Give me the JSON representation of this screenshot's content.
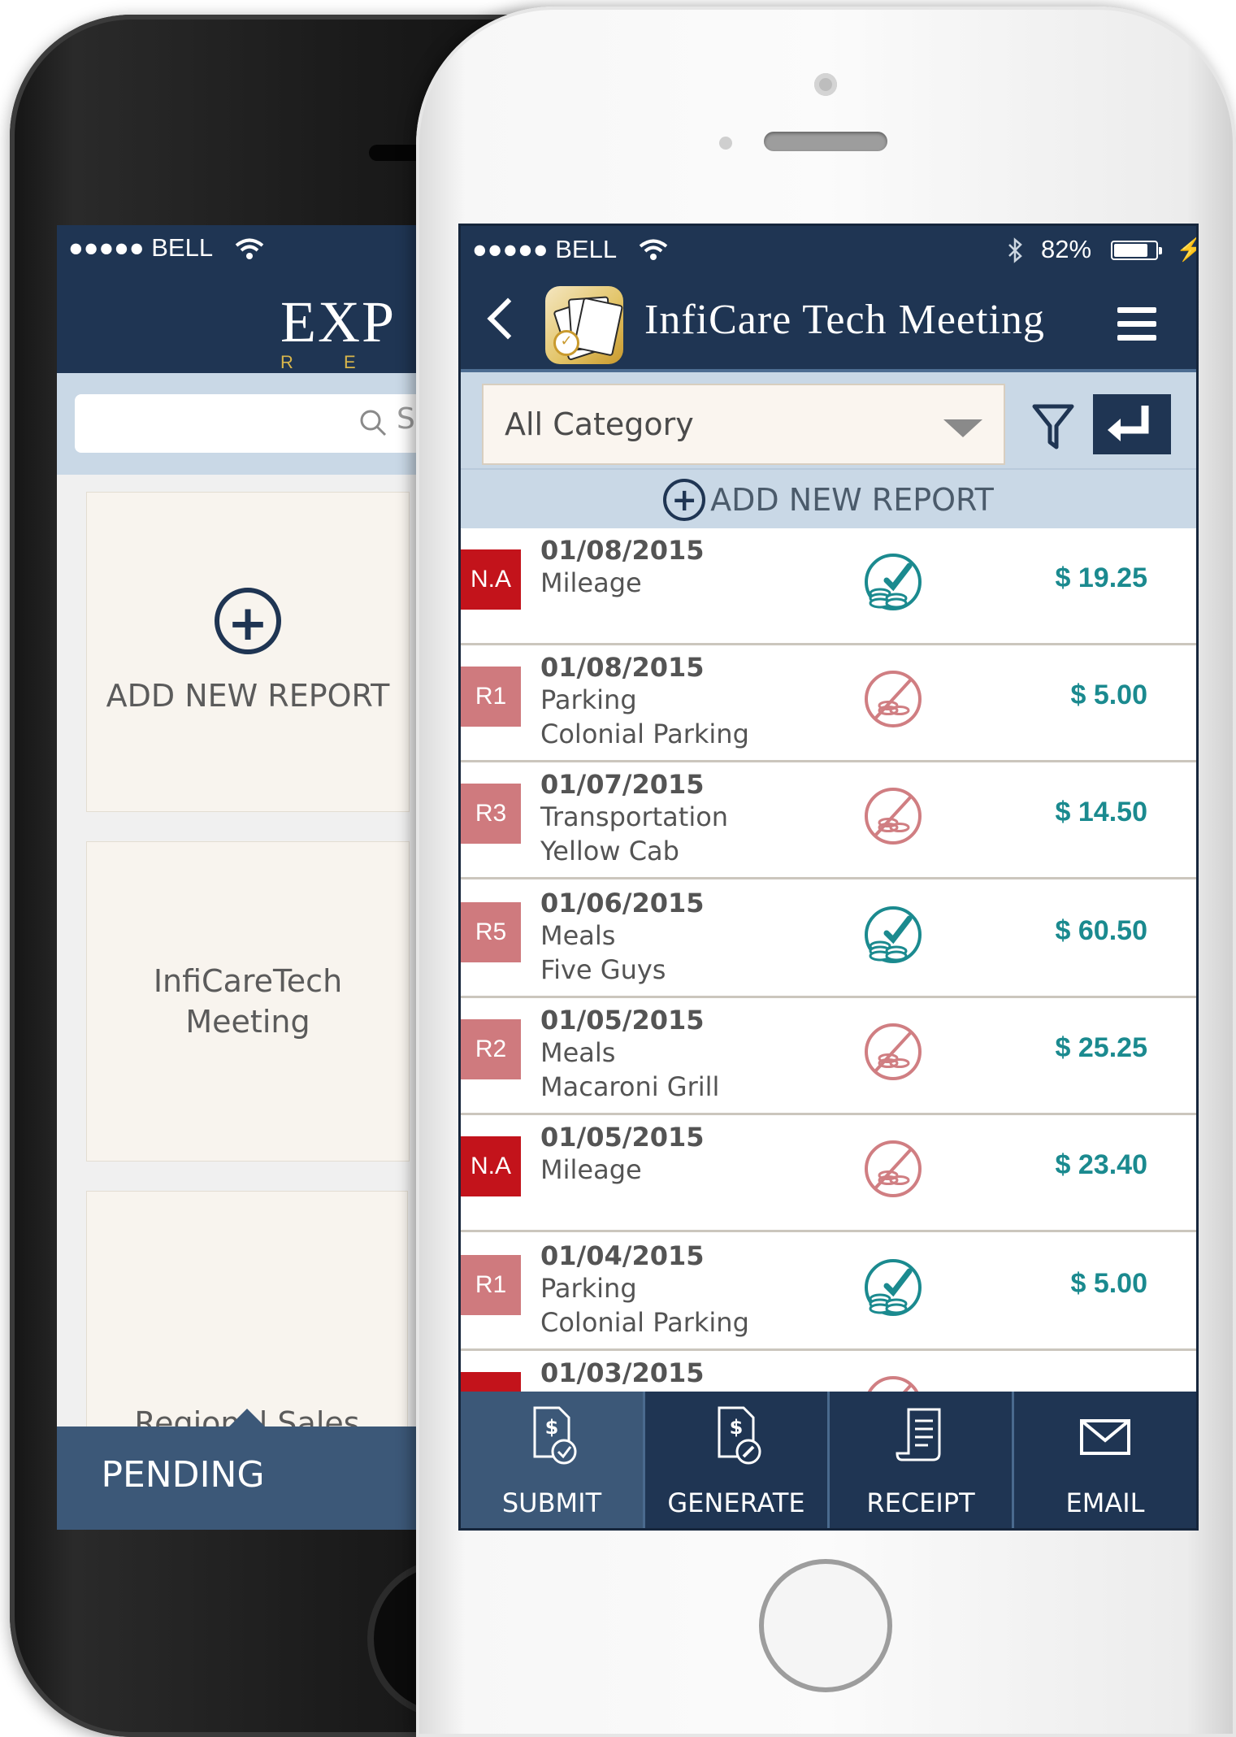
{
  "back_phone": {
    "status": {
      "carrier": "●●●●● BELL"
    },
    "logo": {
      "title": "EXP",
      "subtitle": "R E P"
    },
    "search": {
      "placeholder": "Se"
    },
    "cards": [
      {
        "label": "ADD NEW REPORT",
        "icon": "add-circle-icon"
      },
      {
        "label": "InfiCareTech Meeting"
      },
      {
        "label": "Regional Sales Meeting"
      }
    ],
    "bottom_tab": {
      "label": "PENDING"
    }
  },
  "status_bar": {
    "carrier": "●●●●● BELL",
    "battery_pct": "82%",
    "battery_level": 0.82
  },
  "header": {
    "title": "InfiCare Tech Meeting",
    "back_icon": "chevron-left-icon",
    "menu_icon": "hamburger-icon",
    "app_icon": "expense-app-icon"
  },
  "filter": {
    "category_value": "All Category",
    "filter_icon": "filter-icon",
    "enter_icon": "enter-return-icon"
  },
  "add_report": {
    "label": "ADD NEW REPORT",
    "icon": "add-circle-icon"
  },
  "expenses": [
    {
      "badge": "N.A",
      "badge_type": "na",
      "date": "01/08/2015",
      "category": "Mileage",
      "vendor": "",
      "status": "approved",
      "amount": "$ 19.25"
    },
    {
      "badge": "R1",
      "badge_type": "r",
      "date": "01/08/2015",
      "category": "Parking",
      "vendor": "Colonial Parking",
      "status": "not-submitted",
      "amount": "$ 5.00"
    },
    {
      "badge": "R3",
      "badge_type": "r",
      "date": "01/07/2015",
      "category": "Transportation",
      "vendor": "Yellow Cab",
      "status": "not-submitted",
      "amount": "$ 14.50"
    },
    {
      "badge": "R5",
      "badge_type": "r",
      "date": "01/06/2015",
      "category": "Meals",
      "vendor": "Five Guys",
      "status": "approved",
      "amount": "$ 60.50"
    },
    {
      "badge": "R2",
      "badge_type": "r",
      "date": "01/05/2015",
      "category": "Meals",
      "vendor": "Macaroni Grill",
      "status": "not-submitted",
      "amount": "$ 25.25"
    },
    {
      "badge": "N.A",
      "badge_type": "na",
      "date": "01/05/2015",
      "category": "Mileage",
      "vendor": "",
      "status": "not-submitted",
      "amount": "$ 23.40"
    },
    {
      "badge": "R1",
      "badge_type": "r",
      "date": "01/04/2015",
      "category": "Parking",
      "vendor": "Colonial Parking",
      "status": "approved",
      "amount": "$ 5.00"
    },
    {
      "badge": "",
      "badge_type": "na",
      "date": "01/03/2015",
      "category": "",
      "vendor": "",
      "status": "not-submitted",
      "amount": ""
    }
  ],
  "toolbar": [
    {
      "label": "SUBMIT",
      "icon": "submit-dollar-doc-icon",
      "active": true
    },
    {
      "label": "GENERATE",
      "icon": "generate-dollar-doc-icon",
      "active": false
    },
    {
      "label": "RECEIPT",
      "icon": "receipt-icon",
      "active": false
    },
    {
      "label": "EMAIL",
      "icon": "email-icon",
      "active": false
    }
  ],
  "colors": {
    "navy": "#1f3553",
    "light_blue": "#c9d8e6",
    "amount_teal": "#1b8a8f",
    "badge_red": "#c3131b",
    "badge_pink": "#cf7a7e",
    "approved_teal": "#1b8a8f",
    "not_submitted_pink": "#d07e82"
  }
}
